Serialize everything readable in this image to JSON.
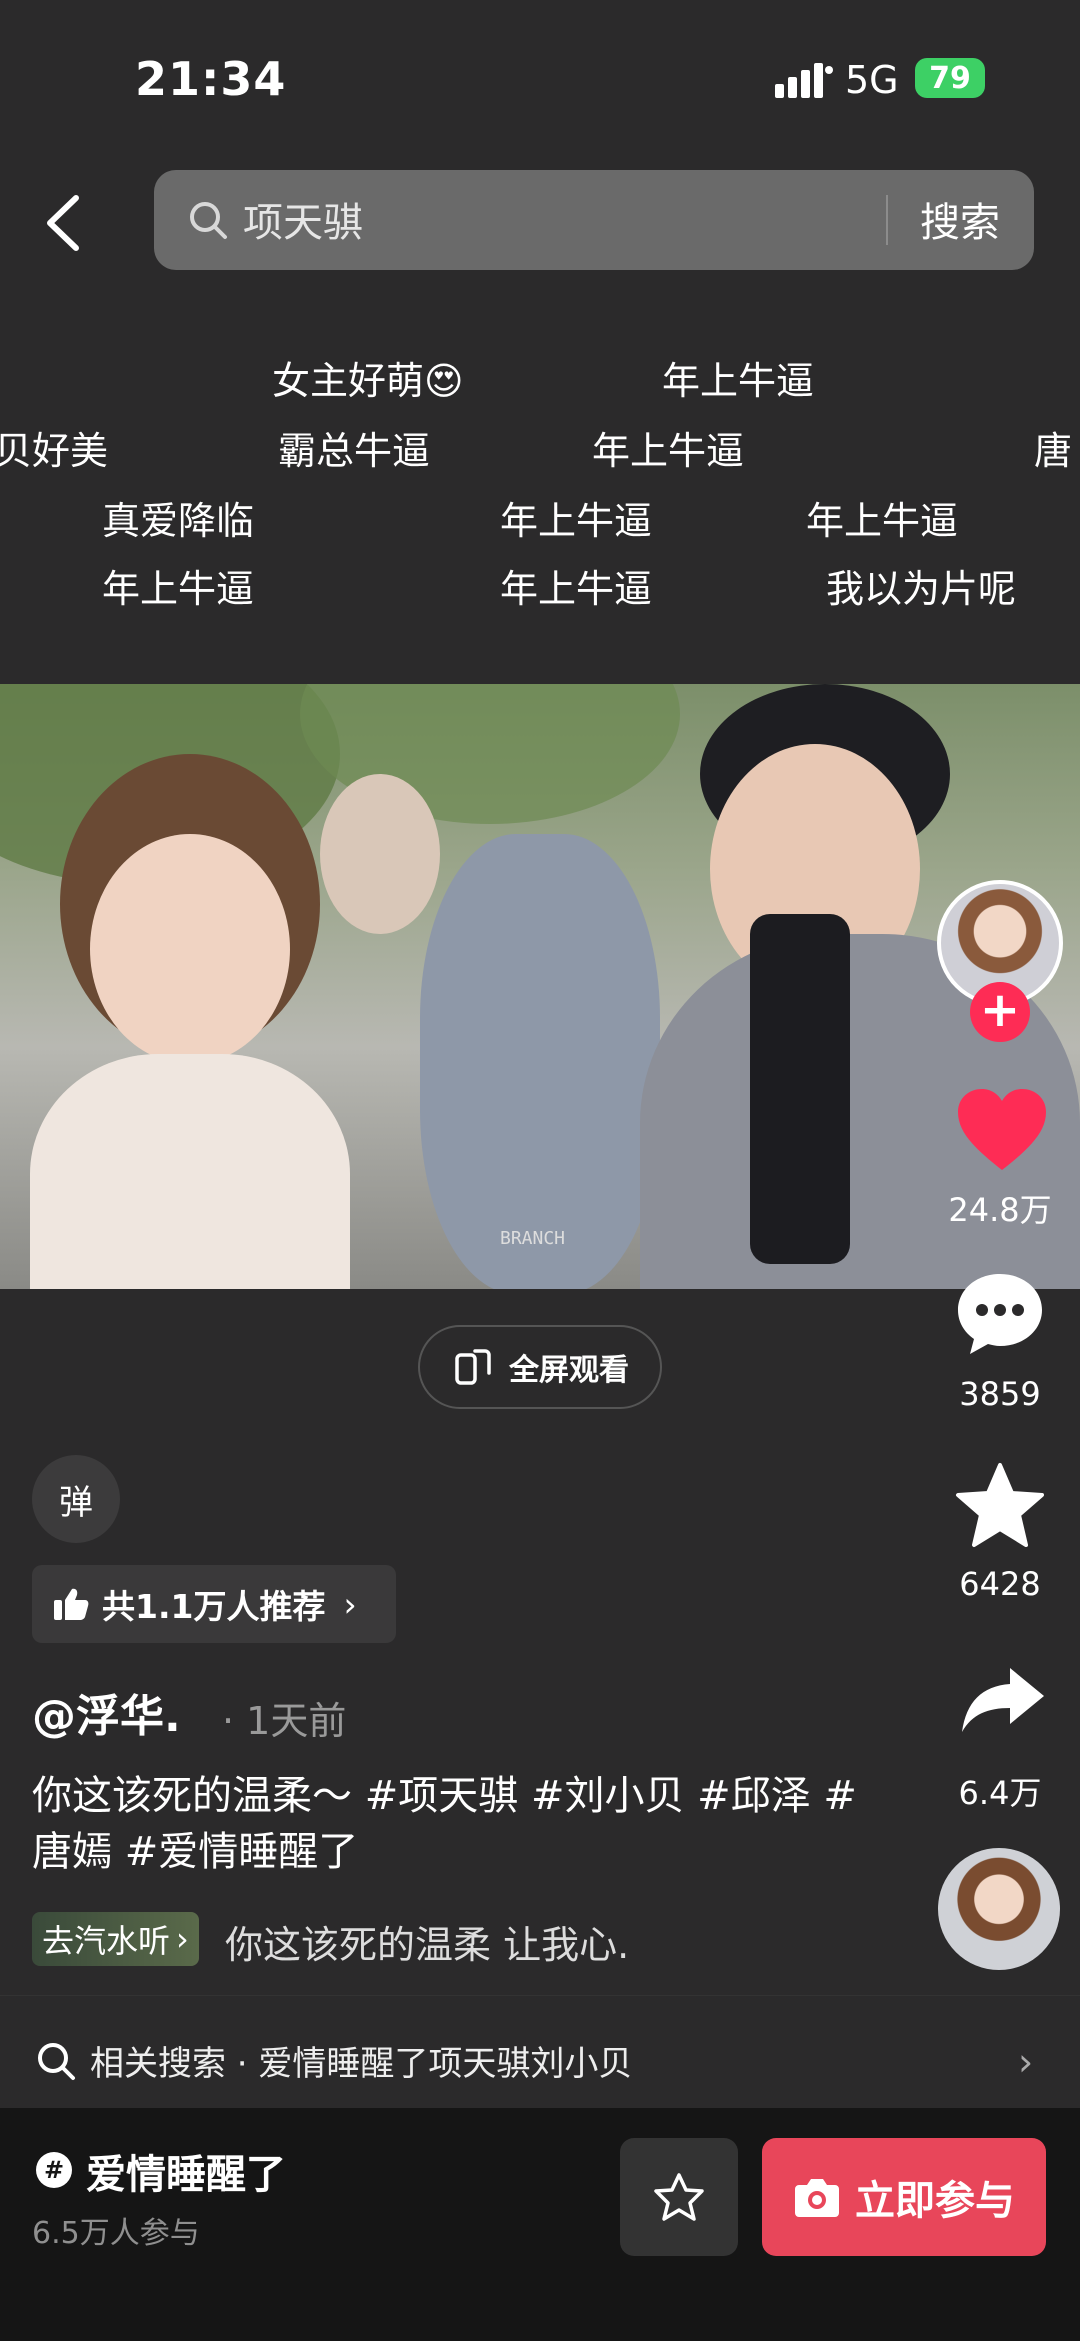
{
  "status_bar": {
    "time": "21:34",
    "network": "5G",
    "battery": "79"
  },
  "search": {
    "query": "项天骐",
    "button": "搜索"
  },
  "danmaku": [
    "女主好萌😍",
    "年上牛逼",
    "贝好美",
    "霸总牛逼",
    "年上牛逼",
    "唐",
    "真爱降临",
    "年上牛逼",
    "年上牛逼",
    "年上牛逼",
    "年上牛逼",
    "我以为片呢"
  ],
  "video": {
    "watermark": "BRANCH"
  },
  "fullscreen_label": "全屏观看",
  "rail": {
    "likes": "24.8万",
    "comments": "3859",
    "favorites": "6428",
    "shares": "6.4万"
  },
  "danmu_toggle": "弹",
  "recommend": {
    "label": "共1.1万人推荐"
  },
  "post": {
    "author": "@浮华.",
    "time": "· 1天前",
    "caption": "你这该死的温柔～ #项天骐 #刘小贝 #邱泽 #唐嫣 #爱情睡醒了",
    "music_tag": "去汽水听",
    "music_text": "你这该死的温柔 让我心."
  },
  "related": {
    "label": "相关搜索 · 爱情睡醒了项天骐刘小贝"
  },
  "topic": {
    "icon": "#",
    "title": "爱情睡醒了",
    "count": "6.5万人参与"
  },
  "join_button": "立即参与",
  "colors": {
    "accent": "#fe2c55",
    "join": "#e8465a"
  }
}
